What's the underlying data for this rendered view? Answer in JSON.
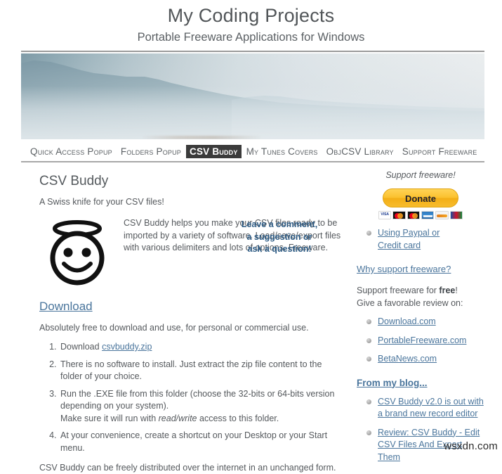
{
  "header": {
    "title": "My Coding Projects",
    "tagline": "Portable Freeware Applications for Windows"
  },
  "nav": {
    "items": [
      {
        "label": "Quick Access Popup",
        "active": false
      },
      {
        "label": "Folders Popup",
        "active": false
      },
      {
        "label": "CSV Buddy",
        "active": true
      },
      {
        "label": "My Tunes Covers",
        "active": false
      },
      {
        "label": "ObjCSV Library",
        "active": false
      },
      {
        "label": "Support Freeware",
        "active": false
      }
    ]
  },
  "main": {
    "page_title": "CSV Buddy",
    "page_subtitle": "A Swiss knife for your CSV files!",
    "intro_paragraph": "CSV Buddy helps you make your CSV files ready to be imported by a variety of software. Load/save/export files with various delimiters and lots of options. Freeware.",
    "comment_callout": [
      "Leave a comment,",
      "a suggestion or",
      "ask a question!"
    ],
    "download_heading": "Download",
    "download_intro": "Absolutely free to download and use, for personal or commercial use.",
    "steps": {
      "step1_prefix": "Download ",
      "step1_link": "csvbuddy.zip",
      "step2": "There is no software to install. Just extract the zip file content to the folder of your choice.",
      "step3_line1": "Run the .EXE file from this folder (choose the 32-bits or 64-bits version depending on your system).",
      "step3_line2_pre": "Make sure it will run with ",
      "step3_line2_em": "read/write",
      "step3_line2_post": " access to this folder.",
      "step4": "At your convenience, create a shortcut on your Desktop or your Start menu."
    },
    "closing_text": "CSV Buddy can be freely distributed over the internet in an unchanged form."
  },
  "sidebar": {
    "support_label": "Support freeware!",
    "donate_label": "Donate",
    "card_icons": [
      "visa-card-icon",
      "mastercard-card-icon",
      "maestro-card-icon",
      "amex-card-icon",
      "discover-card-icon",
      "jcb-card-icon"
    ],
    "paypal_link_line1": "Using Paypal or",
    "paypal_link_line2": "Credit card",
    "why_support_link": "Why support freeware?",
    "free_support_line1_pre": "Support freeware for ",
    "free_support_line1_bold": "free",
    "free_support_line1_post": "!",
    "free_support_line2": "Give a favorable review on:",
    "review_sites": [
      "Download.com",
      "PortableFreeware.com",
      "BetaNews.com"
    ],
    "blog_heading": "From my blog...",
    "blog_posts": [
      {
        "line1": "CSV Buddy v2.0 is out with",
        "line2": "a brand new record editor"
      },
      {
        "line1": "Review: CSV Buddy - Edit",
        "line2": "CSV Files And Export Them"
      }
    ]
  },
  "watermark": "wsxdn.com",
  "colors": {
    "link": "#4a759c",
    "body_text": "#55595d",
    "active_tab_bg": "#3b3b3b",
    "callout_blue": "#2f5d86",
    "donate_yellow": "#fbc12e"
  }
}
